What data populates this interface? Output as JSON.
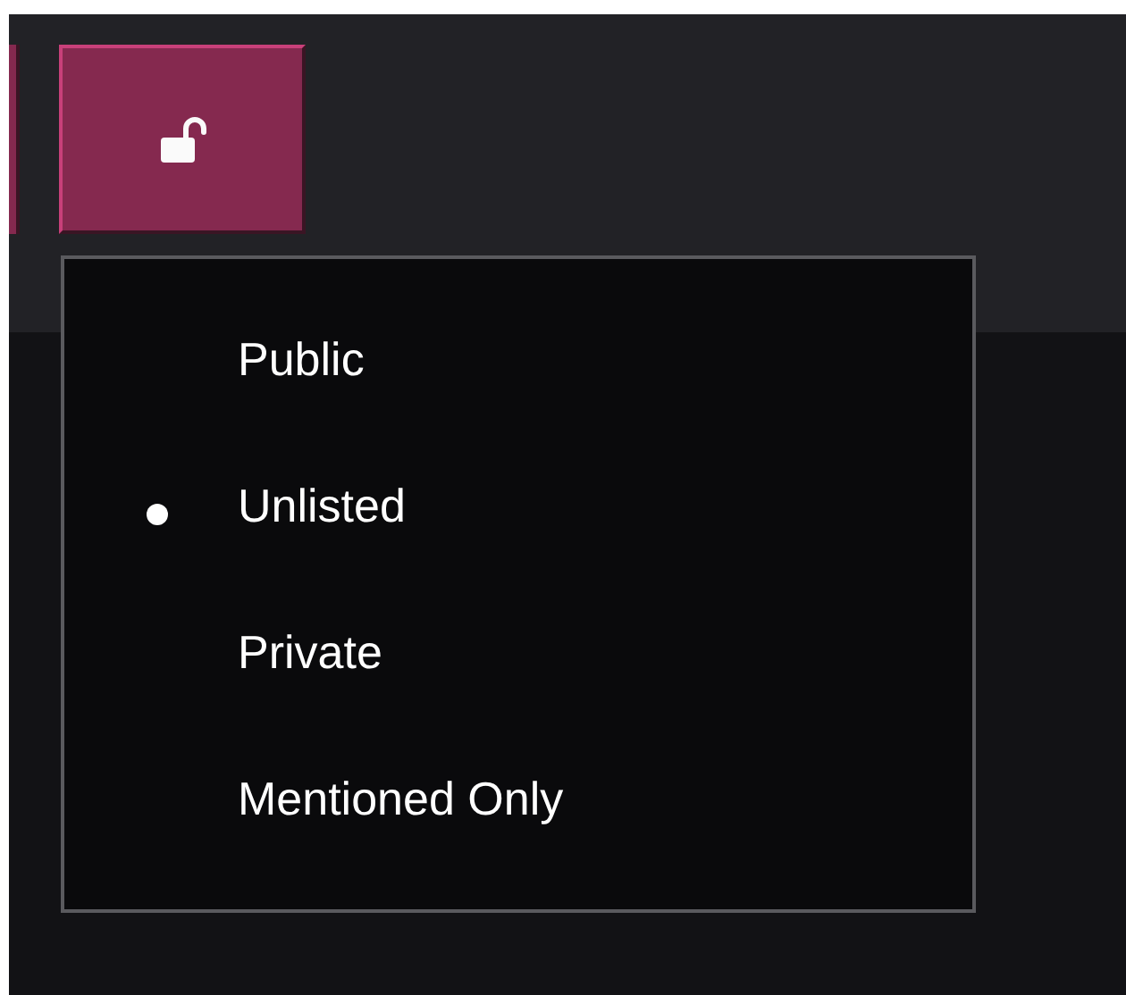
{
  "visibility_menu": {
    "items": [
      {
        "label": "Public",
        "selected": false
      },
      {
        "label": "Unlisted",
        "selected": true
      },
      {
        "label": "Private",
        "selected": false
      },
      {
        "label": "Mentioned Only",
        "selected": false
      }
    ]
  }
}
